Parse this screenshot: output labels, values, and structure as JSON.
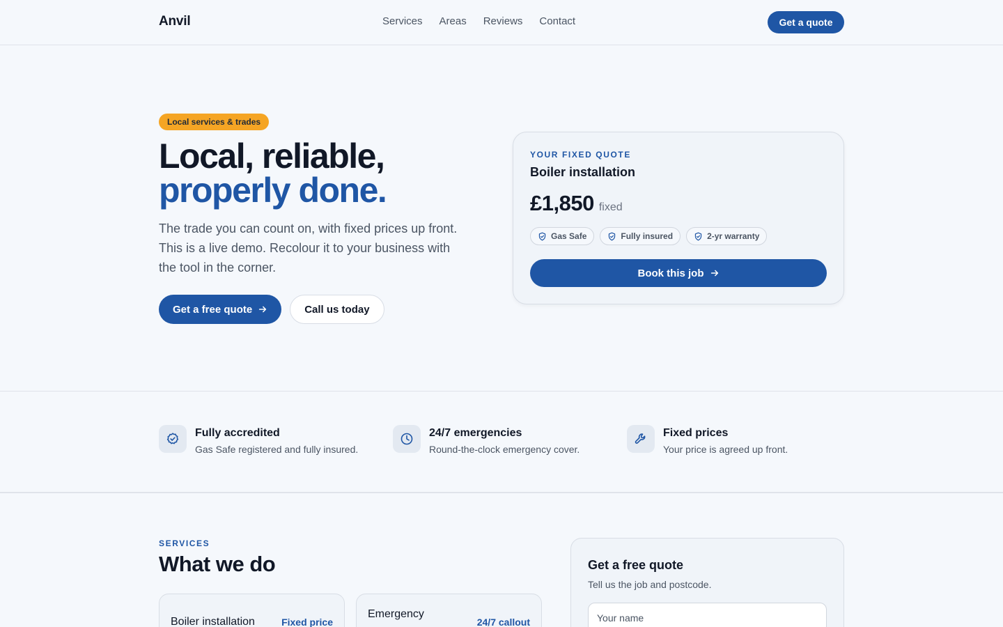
{
  "header": {
    "brand": "Anvil",
    "nav": [
      "Services",
      "Areas",
      "Reviews",
      "Contact"
    ],
    "cta": "Get a quote"
  },
  "hero": {
    "tag": "Local services & trades",
    "title_line1": "Local, reliable,",
    "title_line2": "properly done.",
    "subtitle": "The trade you can count on, with fixed prices up front. This is a live demo. Recolour it to your business with the tool in the corner.",
    "primary_cta": "Get a free quote",
    "secondary_cta": "Call us today"
  },
  "quote_card": {
    "eyebrow": "YOUR FIXED QUOTE",
    "title": "Boiler installation",
    "price": "£1,850",
    "price_unit": "fixed",
    "badges": [
      "Gas Safe",
      "Fully insured",
      "2-yr warranty"
    ],
    "book_label": "Book this job"
  },
  "features": [
    {
      "icon": "check-badge-icon",
      "title": "Fully accredited",
      "desc": "Gas Safe registered and fully insured."
    },
    {
      "icon": "clock-icon",
      "title": "24/7 emergencies",
      "desc": "Round-the-clock emergency cover."
    },
    {
      "icon": "wrench-icon",
      "title": "Fixed prices",
      "desc": "Your price is agreed up front."
    }
  ],
  "services": {
    "eyebrow": "SERVICES",
    "title": "What we do",
    "cards": [
      {
        "name": "Boiler installation",
        "tag": "Fixed price"
      },
      {
        "name": "Emergency",
        "tag": "24/7 callout"
      }
    ]
  },
  "quote_form": {
    "title": "Get a free quote",
    "subtitle": "Tell us the job and postcode.",
    "name_placeholder": "Your name"
  },
  "colors": {
    "accent": "#1f56a5",
    "tag": "#f5a524",
    "background": "#f5f8fc"
  }
}
